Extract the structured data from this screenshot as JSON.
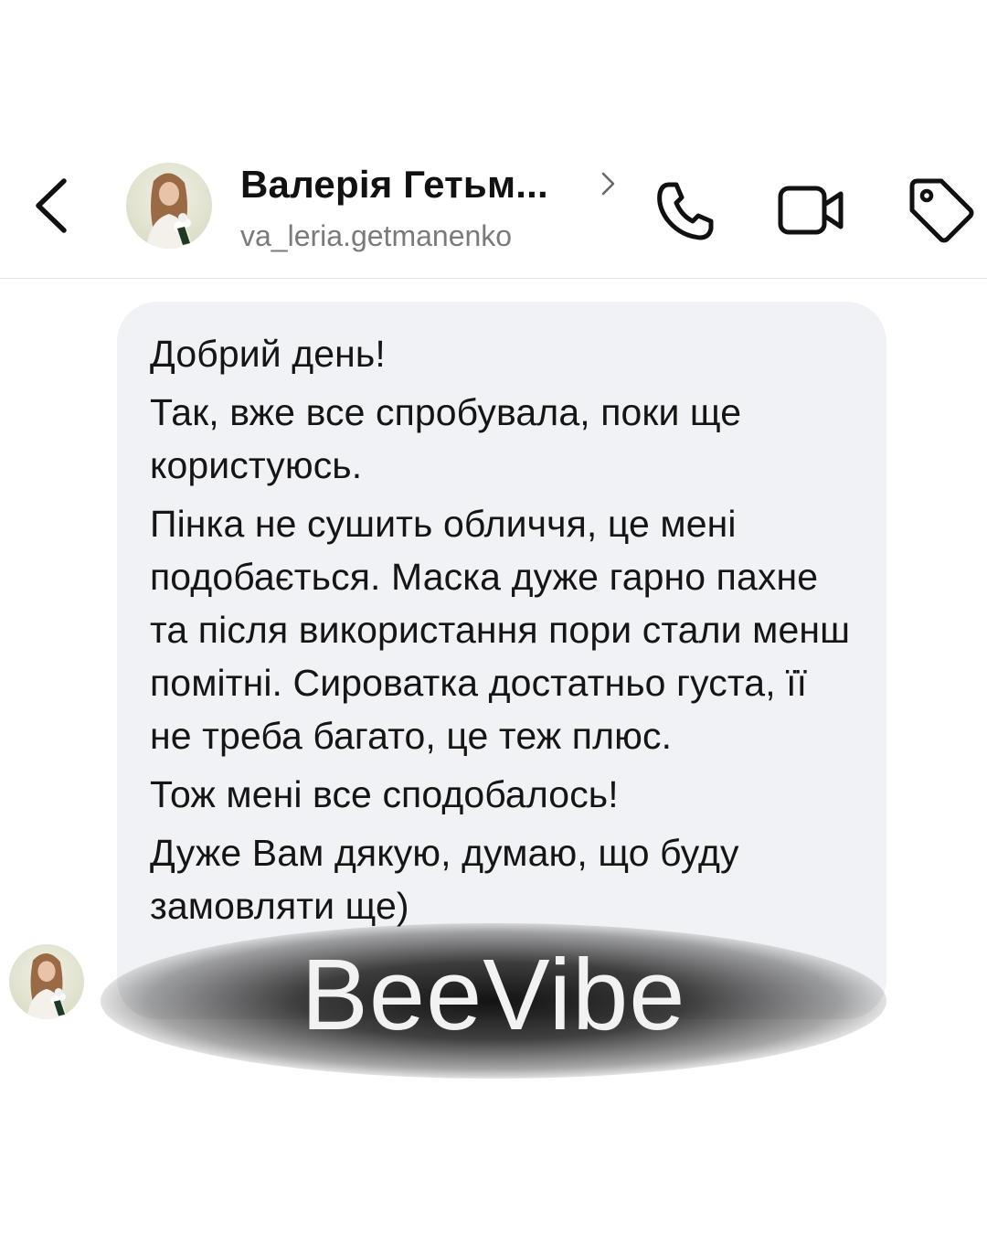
{
  "header": {
    "back_icon": "chevron-left-icon",
    "contact_name": "Валерія Гетьм...",
    "username": "va_leria.getmanenko",
    "actions": [
      {
        "name": "phone",
        "icon": "phone-icon"
      },
      {
        "name": "video",
        "icon": "video-camera-icon"
      },
      {
        "name": "tag",
        "icon": "tag-icon"
      }
    ]
  },
  "message": {
    "paragraphs": [
      "Добрий день!",
      "Так, вже все спробувала, поки ще користуюсь.",
      "Пінка не сушить обличчя, це мені подобається. Маска дуже гарно пахне та після використання пори стали менш помітні. Сироватка достатньо густа, її не треба багато, це теж плюс.",
      "Тож мені все сподобалось!",
      "Дуже Вам дякую, думаю, що буду замовляти ще)"
    ]
  },
  "watermark": {
    "text": "BeeVibe"
  },
  "colors": {
    "bubble_bg": "#f1f2f5",
    "text": "#151515",
    "secondary_text": "#7a7a7a",
    "divider": "#e4e4e4"
  }
}
